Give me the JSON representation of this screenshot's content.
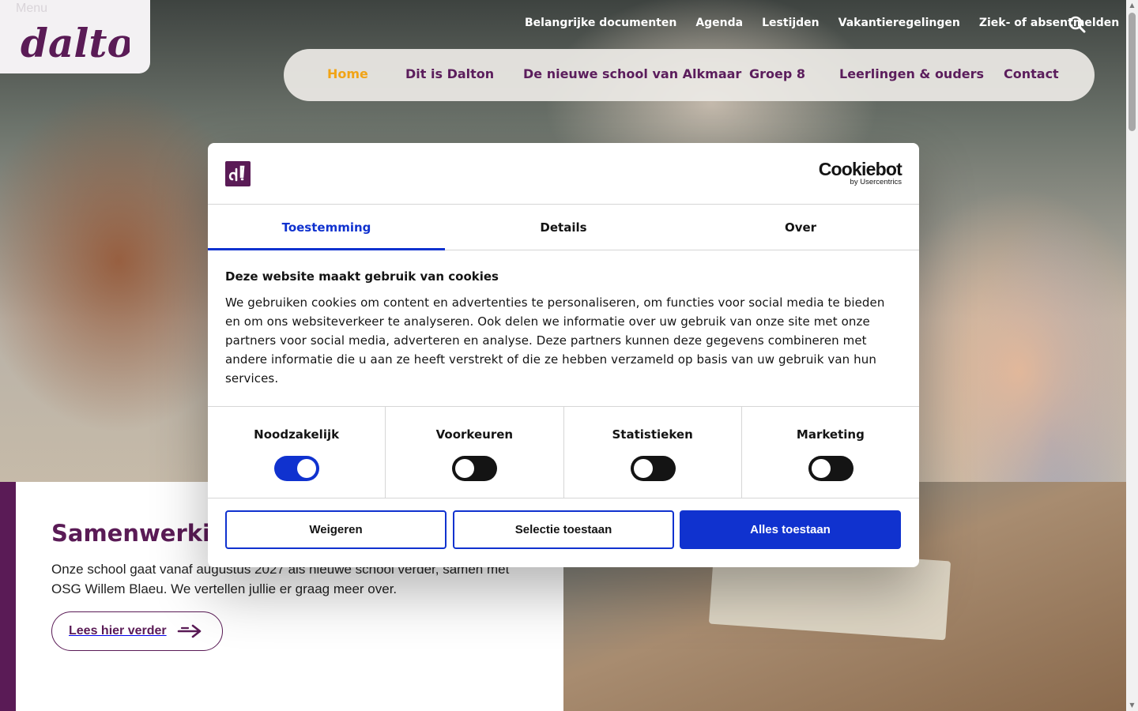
{
  "site": {
    "menu_label": "Menu",
    "logo_alt": "dalton",
    "top_links": [
      "Belangrijke documenten",
      "Agenda",
      "Lestijden",
      "Vakantieregelingen",
      "Ziek- of absentmelden"
    ],
    "search_icon": "search-icon",
    "main_nav": [
      {
        "label": "Home",
        "active": true
      },
      {
        "label": "Dit is Dalton",
        "active": false
      },
      {
        "label": "De nieuwe school van Alkmaar",
        "active": false
      },
      {
        "label": "Groep 8",
        "active": false
      },
      {
        "label": "Leerlingen & ouders",
        "active": false
      },
      {
        "label": "Contact",
        "active": false
      }
    ]
  },
  "hero_card": {
    "title": "Samenwerking",
    "text": "Onze school gaat vanaf augustus 2027 als nieuwe school verder, samen met OSG Willem Blaeu. We vertellen jullie er graag meer over.",
    "cta_label": "Lees hier verder",
    "cta_icon": "arrow-right-icon"
  },
  "cookie_dialog": {
    "brand_name": "Cookiebot",
    "brand_sub": "by Usercentrics",
    "tabs": [
      {
        "label": "Toestemming",
        "active": true
      },
      {
        "label": "Details",
        "active": false
      },
      {
        "label": "Over",
        "active": false
      }
    ],
    "title": "Deze website maakt gebruik van cookies",
    "text": "We gebruiken cookies om content en advertenties te personaliseren, om functies voor social media te bieden en om ons websiteverkeer te analyseren. Ook delen we informatie over uw gebruik van onze site met onze partners voor social media, adverteren en analyse. Deze partners kunnen deze gegevens combineren met andere informatie die u aan ze heeft verstrekt of die ze hebben verzameld op basis van uw gebruik van hun services.",
    "toggles": [
      {
        "label": "Noodzakelijk",
        "on": true
      },
      {
        "label": "Voorkeuren",
        "on": false
      },
      {
        "label": "Statistieken",
        "on": false
      },
      {
        "label": "Marketing",
        "on": false
      }
    ],
    "buttons": {
      "reject": "Weigeren",
      "selection": "Selectie toestaan",
      "accept_all": "Alles toestaan"
    }
  },
  "colors": {
    "brand_purple": "#5a1b56",
    "nav_active": "#f1a416",
    "cookiebot_blue": "#1032cf"
  }
}
